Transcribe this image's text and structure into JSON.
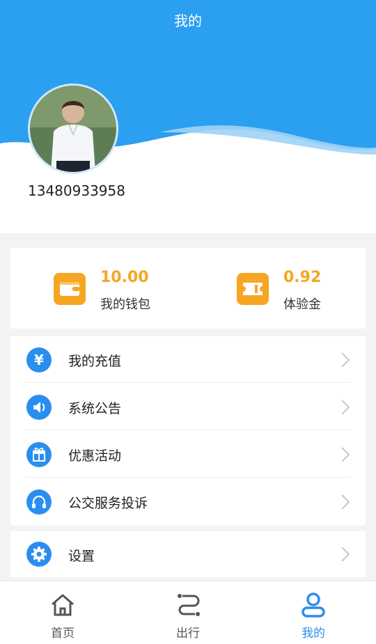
{
  "header": {
    "title": "我的"
  },
  "profile": {
    "phone": "13480933958",
    "avatar_icon": "user-avatar"
  },
  "wallet": [
    {
      "icon": "wallet-icon",
      "value": "10.00",
      "label": "我的钱包"
    },
    {
      "icon": "ticket-icon",
      "value": "0.92",
      "label": "体验金"
    }
  ],
  "menu": [
    {
      "icon": "yuan-icon",
      "label": "我的充值"
    },
    {
      "icon": "speaker-icon",
      "label": "系统公告"
    },
    {
      "icon": "gift-icon",
      "label": "优惠活动"
    },
    {
      "icon": "headset-icon",
      "label": "公交服务投诉"
    }
  ],
  "settings": {
    "icon": "gear-icon",
    "label": "设置"
  },
  "tabbar": [
    {
      "icon": "home-icon",
      "label": "首页",
      "active": false
    },
    {
      "icon": "route-icon",
      "label": "出行",
      "active": false
    },
    {
      "icon": "person-icon",
      "label": "我的",
      "active": true
    }
  ],
  "colors": {
    "primary": "#2a8ef0",
    "header_blue": "#2b9ff0",
    "accent_orange": "#f5a623"
  }
}
